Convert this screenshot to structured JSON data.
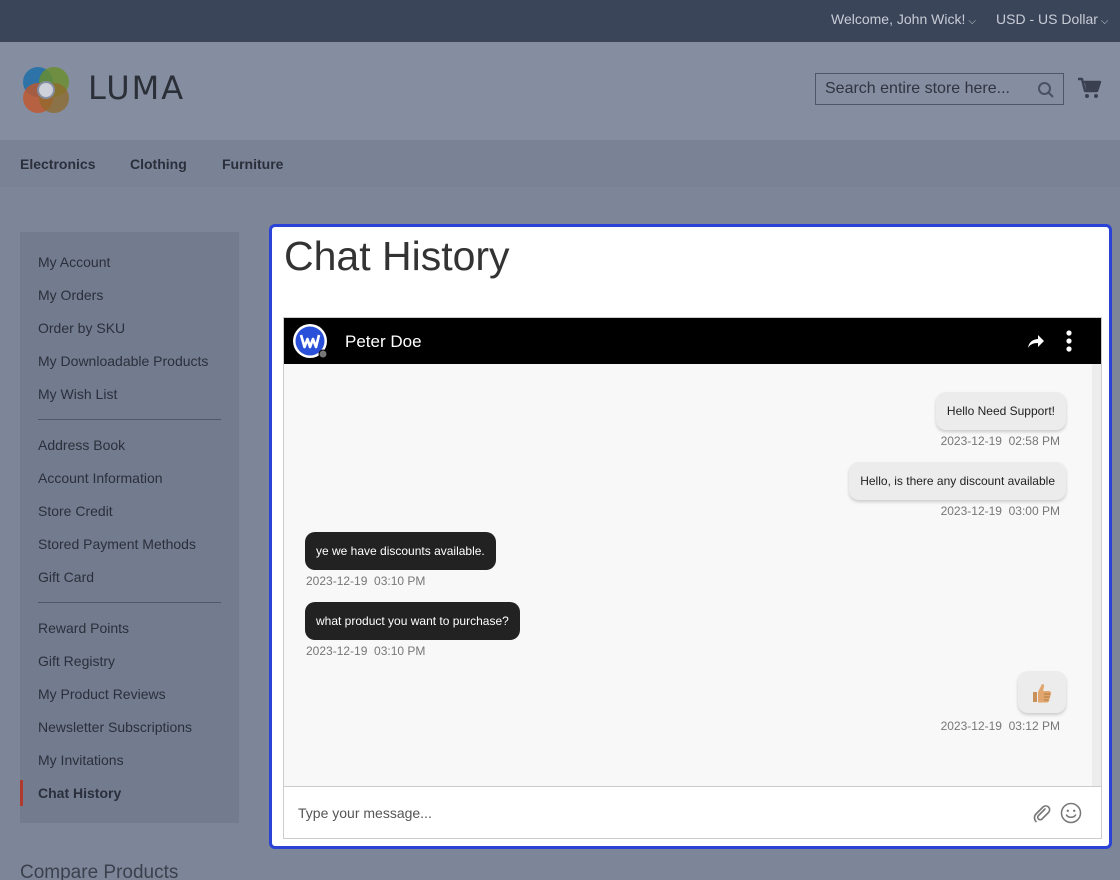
{
  "topbar": {
    "welcome": "Welcome, John Wick!",
    "currency": "USD - US Dollar"
  },
  "header": {
    "logo_text": "LUMA",
    "search_placeholder": "Search entire store here..."
  },
  "nav": {
    "items": [
      "Electronics",
      "Clothing",
      "Furniture"
    ]
  },
  "sidebar": {
    "items": [
      "My Account",
      "My Orders",
      "Order by SKU",
      "My Downloadable Products",
      "My Wish List",
      "Address Book",
      "Account Information",
      "Store Credit",
      "Stored Payment Methods",
      "Gift Card",
      "Reward Points",
      "Gift Registry",
      "My Product Reviews",
      "Newsletter Subscriptions",
      "My Invitations",
      "Chat History"
    ],
    "active": "Chat History",
    "compare": "Compare Products"
  },
  "main": {
    "title": "Chat History",
    "chat": {
      "contact": "Peter Doe",
      "messages": [
        {
          "text": "Hello Need Support!",
          "time": "2023-12-19  02:58 PM",
          "direction": "out"
        },
        {
          "text": "Hello, is there any discount available",
          "time": "2023-12-19  03:00 PM",
          "direction": "out"
        },
        {
          "text": "ye we have discounts available.",
          "time": "2023-12-19  03:10 PM",
          "direction": "in"
        },
        {
          "text": "what product you want to purchase?",
          "time": "2023-12-19  03:10 PM",
          "direction": "in"
        },
        {
          "text": "👍",
          "time": "2023-12-19  03:12 PM",
          "direction": "out"
        }
      ],
      "input_placeholder": "Type your message..."
    }
  },
  "colors": {
    "accent_border": "#2b42d6",
    "active_marker": "#b03a2e",
    "chat_header": "#000000"
  },
  "icons": [
    "chevron-down-icon",
    "search-icon",
    "cart-icon",
    "share-icon",
    "more-vertical-icon",
    "paperclip-icon",
    "smile-icon"
  ]
}
